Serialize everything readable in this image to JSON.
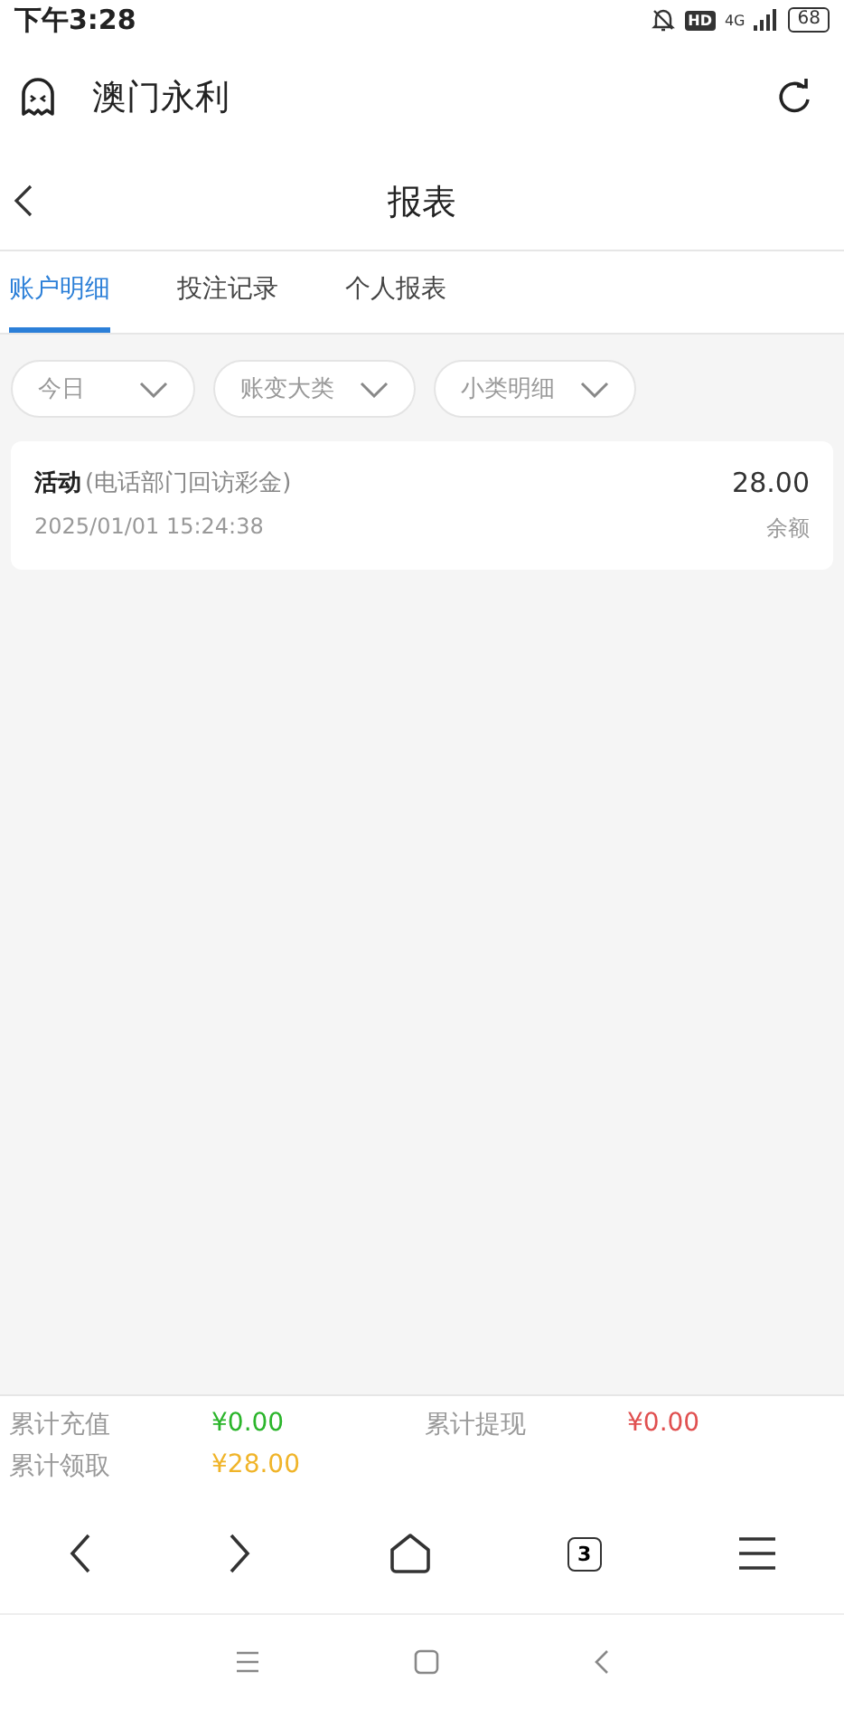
{
  "status_bar": {
    "time": "下午3:28",
    "hd": "HD",
    "network": "4G",
    "battery": "68"
  },
  "app_bar": {
    "title": "澳门永利"
  },
  "header": {
    "title": "报表"
  },
  "tabs": [
    {
      "label": "账户明细",
      "selected": true
    },
    {
      "label": "投注记录",
      "selected": false
    },
    {
      "label": "个人报表",
      "selected": false
    }
  ],
  "filters": [
    {
      "label": "今日"
    },
    {
      "label": "账变大类"
    },
    {
      "label": "小类明细"
    }
  ],
  "records": [
    {
      "type": "活动",
      "note": "(电话部门回访彩金)",
      "time": "2025/01/01 15:24:38",
      "amount": "28.00",
      "amount_label": "余额"
    }
  ],
  "summary": [
    {
      "label": "累计充值",
      "value": "¥0.00",
      "color": "#2bb52b"
    },
    {
      "label": "累计提现",
      "value": "¥0.00",
      "color": "#e05050"
    },
    {
      "label": "累计领取",
      "value": "¥28.00",
      "color": "#f0b429"
    }
  ],
  "browser_nav": {
    "tab_count": "3"
  }
}
